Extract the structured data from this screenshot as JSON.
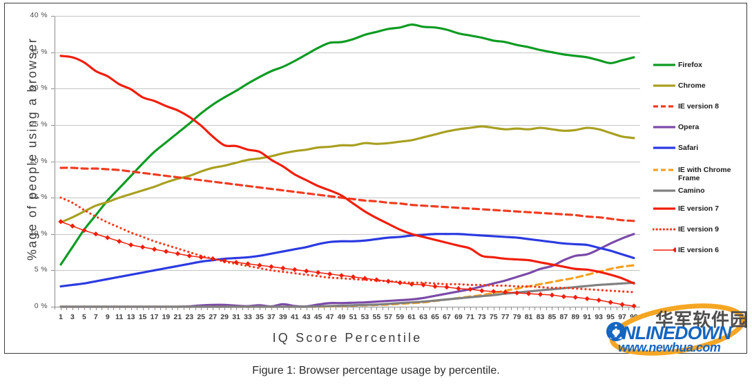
{
  "figure": {
    "caption": "Figure 1: Browser percentage usage by percentile.",
    "x_axis_title": "IQ Score Percentile",
    "y_axis_title": "%age of people using a browser"
  },
  "watermark": {
    "chinese": "华军软件园",
    "brand": "ONLINEDOWN",
    "url": "www.newhua.com",
    "brand_color": "#1565c0",
    "ring_color": "#f5a623"
  },
  "legend": {
    "items": [
      {
        "label": "Firefox",
        "color": "#0d9b22",
        "style": "solid",
        "width": 3
      },
      {
        "label": "Chrome",
        "color": "#a8a020",
        "style": "solid",
        "width": 3
      },
      {
        "label": "IE version 8",
        "color": "#f03b20",
        "style": "dashed",
        "width": 3
      },
      {
        "label": "Opera",
        "color": "#7b4aa8",
        "style": "solid",
        "width": 3
      },
      {
        "label": "Safari",
        "color": "#2b3ae0",
        "style": "solid",
        "width": 3
      },
      {
        "label": "IE with Chrome\nFrame",
        "color": "#f5a020",
        "style": "dashed",
        "width": 3
      },
      {
        "label": "Camino",
        "color": "#808080",
        "style": "solid",
        "width": 3
      },
      {
        "label": "IE version 7",
        "color": "#f01e0a",
        "style": "solid",
        "width": 3
      },
      {
        "label": "IE version 9",
        "color": "#f03b20",
        "style": "dotted",
        "width": 3
      },
      {
        "label": "IE version 6",
        "color": "#f01e0a",
        "style": "marker",
        "width": 1.4
      }
    ]
  },
  "chart_data": {
    "type": "line",
    "title": "",
    "xlabel": "IQ Score Percentile",
    "ylabel": "%age of people using a browser",
    "xlim": [
      1,
      99
    ],
    "ylim": [
      0,
      40
    ],
    "y_ticks": [
      0,
      5,
      10,
      15,
      20,
      25,
      30,
      35,
      40
    ],
    "y_tick_labels": [
      "0 %",
      "5 %",
      "10 %",
      "15 %",
      "20 %",
      "25 %",
      "30 %",
      "35 %",
      "40 %"
    ],
    "x_ticks": [
      1,
      3,
      5,
      7,
      9,
      11,
      13,
      15,
      17,
      19,
      21,
      23,
      25,
      27,
      29,
      31,
      33,
      35,
      37,
      39,
      41,
      43,
      45,
      47,
      49,
      51,
      53,
      55,
      57,
      59,
      61,
      63,
      65,
      67,
      69,
      71,
      73,
      75,
      77,
      79,
      81,
      83,
      85,
      87,
      89,
      91,
      93,
      95,
      97,
      99
    ],
    "grid": "horizontal",
    "legend_position": "right",
    "x": [
      1,
      3,
      5,
      7,
      9,
      11,
      13,
      15,
      17,
      19,
      21,
      23,
      25,
      27,
      29,
      31,
      33,
      35,
      37,
      39,
      41,
      43,
      45,
      47,
      49,
      51,
      53,
      55,
      57,
      59,
      61,
      63,
      65,
      67,
      69,
      71,
      73,
      75,
      77,
      79,
      81,
      83,
      85,
      87,
      89,
      91,
      93,
      95,
      97,
      99
    ],
    "series": [
      {
        "name": "Firefox",
        "color": "#0d9b22",
        "style": "solid",
        "values": [
          5.8,
          8.2,
          10.6,
          12.6,
          14.6,
          16.3,
          18.0,
          19.7,
          21.3,
          22.6,
          23.9,
          25.2,
          26.6,
          27.8,
          28.8,
          29.7,
          30.7,
          31.6,
          32.4,
          33.0,
          33.8,
          34.7,
          35.6,
          36.3,
          36.4,
          36.8,
          37.4,
          37.8,
          38.2,
          38.4,
          38.8,
          38.5,
          38.4,
          38.1,
          37.6,
          37.3,
          37.0,
          36.6,
          36.4,
          36.0,
          35.7,
          35.3,
          35.0,
          34.7,
          34.5,
          34.3,
          33.9,
          33.5,
          33.9,
          34.3
        ]
      },
      {
        "name": "Chrome",
        "color": "#a8a020",
        "style": "solid",
        "values": [
          11.6,
          12.3,
          13.1,
          13.9,
          14.4,
          15.0,
          15.5,
          16.0,
          16.5,
          17.1,
          17.6,
          18.0,
          18.6,
          19.1,
          19.4,
          19.8,
          20.2,
          20.4,
          20.7,
          21.1,
          21.4,
          21.6,
          21.9,
          22.0,
          22.2,
          22.2,
          22.5,
          22.4,
          22.5,
          22.7,
          22.9,
          23.3,
          23.7,
          24.1,
          24.4,
          24.6,
          24.8,
          24.6,
          24.4,
          24.5,
          24.4,
          24.6,
          24.4,
          24.2,
          24.3,
          24.6,
          24.4,
          23.9,
          23.4,
          23.2
        ]
      },
      {
        "name": "IE version 8",
        "color": "#f03b20",
        "style": "dashed",
        "values": [
          19.1,
          19.1,
          19.0,
          19.0,
          18.9,
          18.8,
          18.6,
          18.4,
          18.2,
          18.0,
          17.8,
          17.6,
          17.4,
          17.2,
          17.0,
          16.8,
          16.6,
          16.4,
          16.2,
          16.0,
          15.8,
          15.6,
          15.4,
          15.2,
          15.0,
          14.8,
          14.6,
          14.5,
          14.3,
          14.2,
          14.0,
          13.9,
          13.8,
          13.7,
          13.6,
          13.5,
          13.4,
          13.3,
          13.2,
          13.1,
          13.0,
          12.9,
          12.8,
          12.7,
          12.6,
          12.4,
          12.3,
          12.1,
          11.9,
          11.8
        ]
      },
      {
        "name": "Opera",
        "color": "#7b4aa8",
        "style": "solid",
        "values": [
          0.0,
          0.0,
          0.0,
          0.0,
          0.0,
          0.0,
          0.0,
          0.0,
          0.0,
          0.0,
          0.0,
          0.05,
          0.18,
          0.25,
          0.25,
          0.15,
          0.08,
          0.2,
          0.05,
          0.35,
          0.1,
          0.05,
          0.3,
          0.5,
          0.5,
          0.55,
          0.6,
          0.7,
          0.8,
          0.9,
          1.0,
          1.2,
          1.5,
          1.8,
          2.1,
          2.4,
          2.8,
          3.2,
          3.6,
          4.1,
          4.6,
          5.2,
          5.6,
          6.4,
          7.0,
          7.2,
          7.9,
          8.7,
          9.4,
          10.0
        ]
      },
      {
        "name": "Safari",
        "color": "#2b3ae0",
        "style": "solid",
        "values": [
          2.8,
          3.0,
          3.2,
          3.5,
          3.8,
          4.1,
          4.4,
          4.7,
          5.0,
          5.3,
          5.6,
          5.9,
          6.2,
          6.4,
          6.6,
          6.7,
          6.8,
          7.0,
          7.3,
          7.6,
          7.9,
          8.2,
          8.6,
          8.9,
          9.0,
          9.0,
          9.1,
          9.3,
          9.5,
          9.6,
          9.8,
          9.9,
          10.0,
          10.0,
          10.0,
          9.9,
          9.8,
          9.7,
          9.6,
          9.5,
          9.3,
          9.1,
          8.9,
          8.7,
          8.6,
          8.5,
          8.1,
          7.7,
          7.2,
          6.7
        ]
      },
      {
        "name": "IE with Chrome Frame",
        "color": "#f5a020",
        "style": "dashed",
        "values": [
          0.0,
          0.0,
          0.0,
          0.0,
          0.0,
          0.0,
          0.0,
          0.0,
          0.0,
          0.0,
          0.0,
          0.0,
          0.0,
          0.0,
          0.0,
          0.0,
          0.0,
          0.0,
          0.0,
          0.0,
          0.0,
          0.0,
          0.0,
          0.05,
          0.1,
          0.15,
          0.2,
          0.25,
          0.3,
          0.4,
          0.5,
          0.6,
          0.8,
          1.0,
          1.2,
          1.4,
          1.6,
          1.9,
          2.2,
          2.5,
          2.8,
          3.1,
          3.4,
          3.7,
          4.0,
          4.4,
          4.8,
          5.2,
          5.5,
          5.7
        ]
      },
      {
        "name": "Camino",
        "color": "#808080",
        "style": "solid",
        "values": [
          0.0,
          0.0,
          0.0,
          0.0,
          0.0,
          0.0,
          0.0,
          0.0,
          0.0,
          0.0,
          0.0,
          0.0,
          0.0,
          0.0,
          0.0,
          0.0,
          0.0,
          0.0,
          0.0,
          0.0,
          0.0,
          0.0,
          0.05,
          0.1,
          0.15,
          0.2,
          0.25,
          0.3,
          0.4,
          0.5,
          0.6,
          0.7,
          0.85,
          1.0,
          1.15,
          1.3,
          1.45,
          1.6,
          1.8,
          1.95,
          2.1,
          2.25,
          2.4,
          2.55,
          2.7,
          2.85,
          3.0,
          3.1,
          3.2,
          3.3
        ]
      },
      {
        "name": "IE version 7",
        "color": "#f01e0a",
        "style": "solid",
        "values": [
          34.5,
          34.3,
          33.6,
          32.4,
          31.7,
          30.6,
          29.9,
          28.8,
          28.3,
          27.6,
          27.0,
          26.1,
          24.9,
          23.4,
          22.2,
          22.1,
          21.6,
          21.3,
          20.2,
          19.3,
          18.2,
          17.4,
          16.6,
          16.0,
          15.3,
          14.2,
          13.1,
          12.2,
          11.4,
          10.6,
          10.0,
          9.6,
          9.2,
          8.8,
          8.4,
          8.0,
          7.0,
          6.8,
          6.6,
          6.5,
          6.4,
          6.1,
          5.8,
          5.5,
          5.2,
          5.1,
          4.8,
          4.4,
          3.9,
          3.2
        ]
      },
      {
        "name": "IE version 9",
        "color": "#f03b20",
        "style": "dotted",
        "values": [
          15.0,
          14.3,
          13.3,
          12.4,
          11.6,
          10.9,
          10.2,
          9.6,
          9.0,
          8.5,
          8.0,
          7.5,
          7.0,
          6.6,
          6.2,
          5.9,
          5.6,
          5.3,
          5.0,
          4.8,
          4.6,
          4.4,
          4.2,
          4.0,
          3.9,
          3.8,
          3.7,
          3.6,
          3.5,
          3.4,
          3.3,
          3.3,
          3.2,
          3.1,
          3.1,
          3.0,
          3.0,
          2.9,
          2.9,
          2.8,
          2.8,
          2.7,
          2.6,
          2.6,
          2.5,
          2.4,
          2.3,
          2.2,
          2.1,
          2.0
        ]
      },
      {
        "name": "IE version 6",
        "color": "#f01e0a",
        "style": "marker",
        "values": [
          11.7,
          11.1,
          10.5,
          10.0,
          9.5,
          9.0,
          8.5,
          8.2,
          7.9,
          7.6,
          7.3,
          7.0,
          6.8,
          6.6,
          6.3,
          6.1,
          5.9,
          5.7,
          5.5,
          5.3,
          5.1,
          4.9,
          4.7,
          4.5,
          4.3,
          4.1,
          3.9,
          3.7,
          3.5,
          3.3,
          3.1,
          3.0,
          2.8,
          2.7,
          2.5,
          2.4,
          2.2,
          2.1,
          2.0,
          1.9,
          1.8,
          1.7,
          1.6,
          1.4,
          1.3,
          1.1,
          0.9,
          0.6,
          0.3,
          0.1
        ]
      }
    ]
  }
}
